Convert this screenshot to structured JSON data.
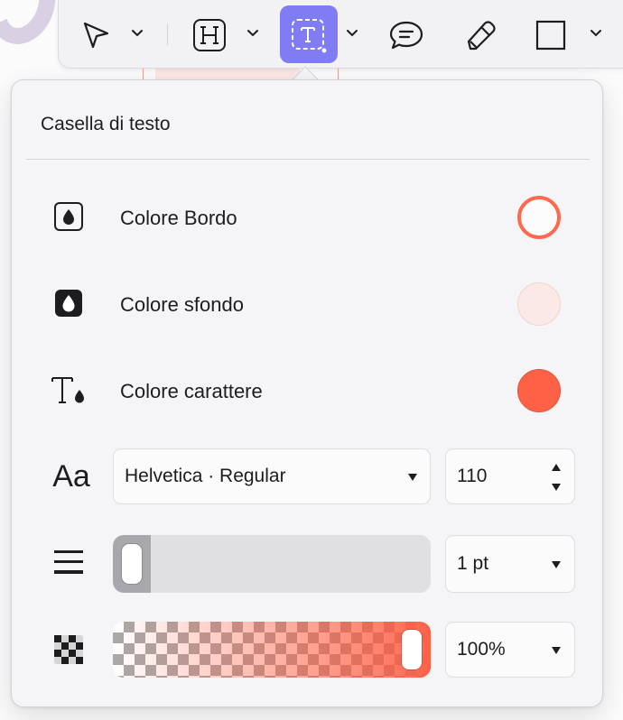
{
  "colors": {
    "accent": "#7f7cf4",
    "border_color": "#ff6a4f",
    "background_color": "#fbe9e7",
    "text_color": "#ff6147"
  },
  "toolbar": {
    "tools": [
      {
        "name": "select",
        "icon": "pointer-arrow-icon",
        "has_menu": true
      },
      {
        "name": "heading",
        "icon": "heading-h-icon",
        "has_menu": true
      },
      {
        "name": "text-box",
        "icon": "text-box-icon",
        "has_menu": true,
        "active": true
      },
      {
        "name": "comment",
        "icon": "speech-bubble-icon",
        "has_menu": false
      },
      {
        "name": "draw",
        "icon": "pencil-icon",
        "has_menu": false
      },
      {
        "name": "shape",
        "icon": "rectangle-icon",
        "has_menu": true
      }
    ]
  },
  "popover": {
    "title": "Casella di testo",
    "rows": {
      "border": {
        "label": "Colore Bordo",
        "icon": "drop-outline-icon"
      },
      "background": {
        "label": "Colore sfondo",
        "icon": "drop-filled-icon"
      },
      "text": {
        "label": "Colore carattere",
        "icon": "text-drop-icon"
      }
    },
    "font": {
      "icon": "font-aa-icon",
      "icon_text": "Aa",
      "family_style": "Helvetica · Regular",
      "size": "110"
    },
    "line_width": {
      "icon": "line-weight-icon",
      "value": "1 pt",
      "slider_fraction": 0.0
    },
    "opacity": {
      "icon": "checkerboard-icon",
      "value": "100%",
      "slider_fraction": 1.0
    }
  }
}
